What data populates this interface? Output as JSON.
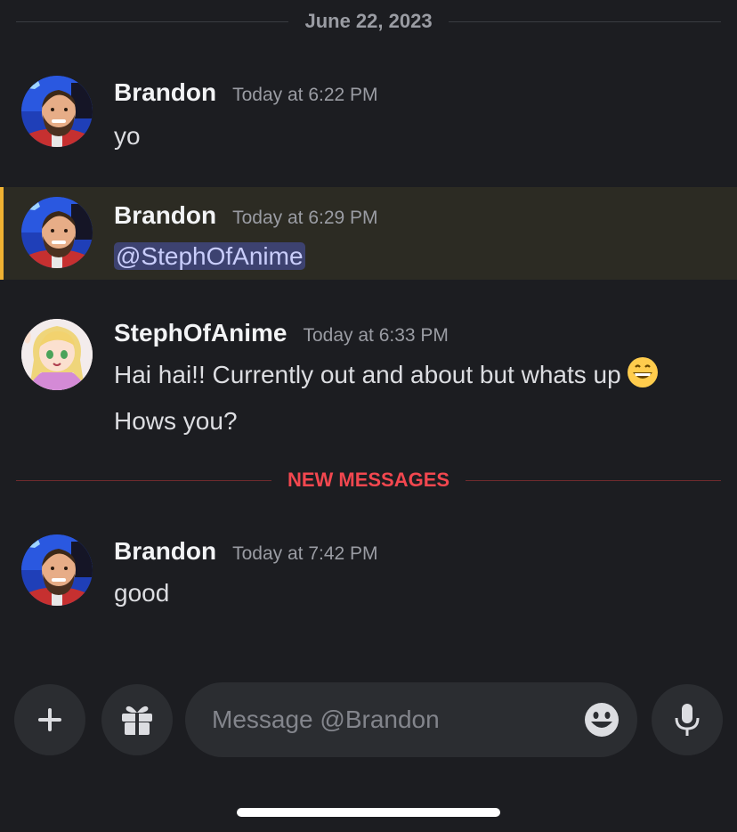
{
  "date_divider": "June 22, 2023",
  "messages": [
    {
      "username": "Brandon",
      "timestamp": "Today at 6:22 PM",
      "text": "yo"
    },
    {
      "username": "Brandon",
      "timestamp": "Today at 6:29 PM",
      "mention": "@StephOfAnime",
      "highlighted": true
    },
    {
      "username": "StephOfAnime",
      "timestamp": "Today at 6:33 PM",
      "line1": "Hai hai!! Currently out and about but whats up",
      "line2": "Hows you?"
    },
    {
      "username": "Brandon",
      "timestamp": "Today at 7:42 PM",
      "text": "good"
    }
  ],
  "new_messages_label": "NEW MESSAGES",
  "composer": {
    "placeholder": "Message @Brandon",
    "add_icon": "plus-icon",
    "gift_icon": "gift-icon",
    "emoji_icon": "smiley-face-icon",
    "voice_icon": "microphone-icon"
  },
  "colors": {
    "background": "#1c1d21",
    "mention_highlight_bar": "#f0b232",
    "new_messages": "#f2474f",
    "mention_pill": "#3d4270"
  }
}
